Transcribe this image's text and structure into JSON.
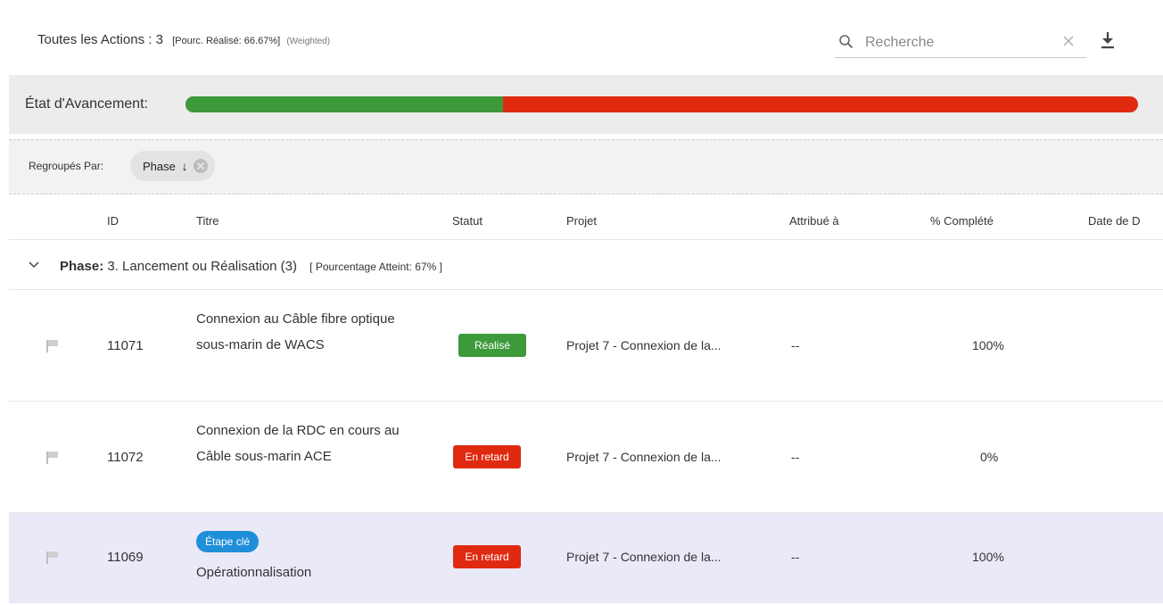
{
  "header": {
    "title": "Toutes les Actions : 3",
    "meta": "[Pourc. Réalisé: 66.67%]",
    "weighted": "(Weighted)",
    "search_placeholder": "Recherche",
    "search_icon": "search-icon",
    "clear_icon": "close-icon",
    "download_icon": "download-icon"
  },
  "progress": {
    "label": "État d'Avancement:",
    "completed_fraction": 0.3333,
    "colors": {
      "done": "#3d9a3b",
      "remaining": "#e02a10"
    }
  },
  "groupby": {
    "label": "Regroupés Par:",
    "chip_label": "Phase",
    "chip_arrow": "↓"
  },
  "columns": [
    "ID",
    "Titre",
    "Statut",
    "Projet",
    "Attribué à",
    "% Complété",
    "Date de D"
  ],
  "group": {
    "prefix": "Phase:",
    "name": "3. Lancement ou Réalisation (3)",
    "pct": "[ Pourcentage Atteint: 67% ]"
  },
  "rows": [
    {
      "id": "11071",
      "title": "Connexion au Câble fibre optique sous-marin de WACS",
      "status": "Réalisé",
      "project": "Projet 7 - Connexion de la...",
      "assigned": "--",
      "percent": "100%"
    },
    {
      "id": "11072",
      "title": "Connexion de la RDC en cours au Câble sous-marin ACE",
      "status": "En retard",
      "project": "Projet 7 - Connexion de la...",
      "assigned": "--",
      "percent": "0%"
    },
    {
      "id": "11069",
      "tag": "Étape clé",
      "title": "Opérationnalisation",
      "status": "En retard",
      "project": "Projet 7 - Connexion de la...",
      "assigned": "--",
      "percent": "100%"
    }
  ]
}
